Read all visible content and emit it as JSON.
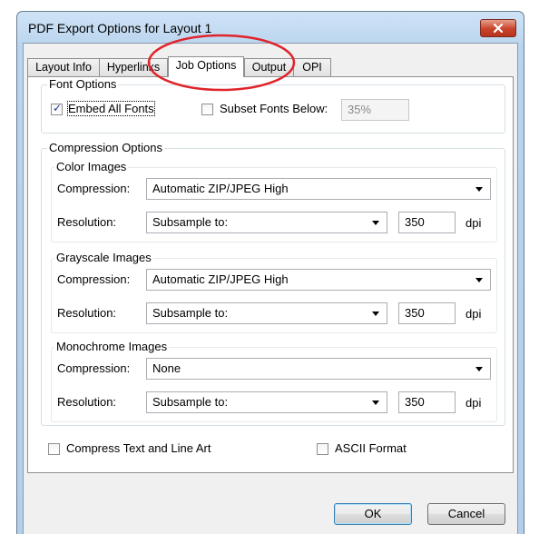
{
  "window": {
    "title": "PDF Export Options for Layout 1"
  },
  "tabs": [
    {
      "label": "Layout Info"
    },
    {
      "label": "Hyperlinks"
    },
    {
      "label": "Job Options"
    },
    {
      "label": "Output"
    },
    {
      "label": "OPI"
    }
  ],
  "active_tab": "Job Options",
  "font_options": {
    "label": "Font Options",
    "embed_all": {
      "label": "Embed All Fonts",
      "checked": true
    },
    "subset": {
      "label": "Subset Fonts Below:",
      "checked": false,
      "value": "35%"
    }
  },
  "compression": {
    "label": "Compression Options",
    "color": {
      "label": "Color Images",
      "compression_label": "Compression:",
      "compression_value": "Automatic ZIP/JPEG High",
      "resolution_label": "Resolution:",
      "resolution_value": "Subsample to:",
      "dpi_value": "350",
      "dpi_unit": "dpi"
    },
    "grayscale": {
      "label": "Grayscale Images",
      "compression_label": "Compression:",
      "compression_value": "Automatic ZIP/JPEG High",
      "resolution_label": "Resolution:",
      "resolution_value": "Subsample to:",
      "dpi_value": "350",
      "dpi_unit": "dpi"
    },
    "monochrome": {
      "label": "Monochrome Images",
      "compression_label": "Compression:",
      "compression_value": "None",
      "resolution_label": "Resolution:",
      "resolution_value": "Subsample to:",
      "dpi_value": "350",
      "dpi_unit": "dpi"
    }
  },
  "compress_text": {
    "label": "Compress Text and Line Art",
    "checked": false
  },
  "ascii_format": {
    "label": "ASCII Format",
    "checked": false
  },
  "buttons": {
    "ok": "OK",
    "cancel": "Cancel"
  },
  "colors": {
    "annotation_ellipse": "#e0242b",
    "close_button": "#c7432b"
  }
}
